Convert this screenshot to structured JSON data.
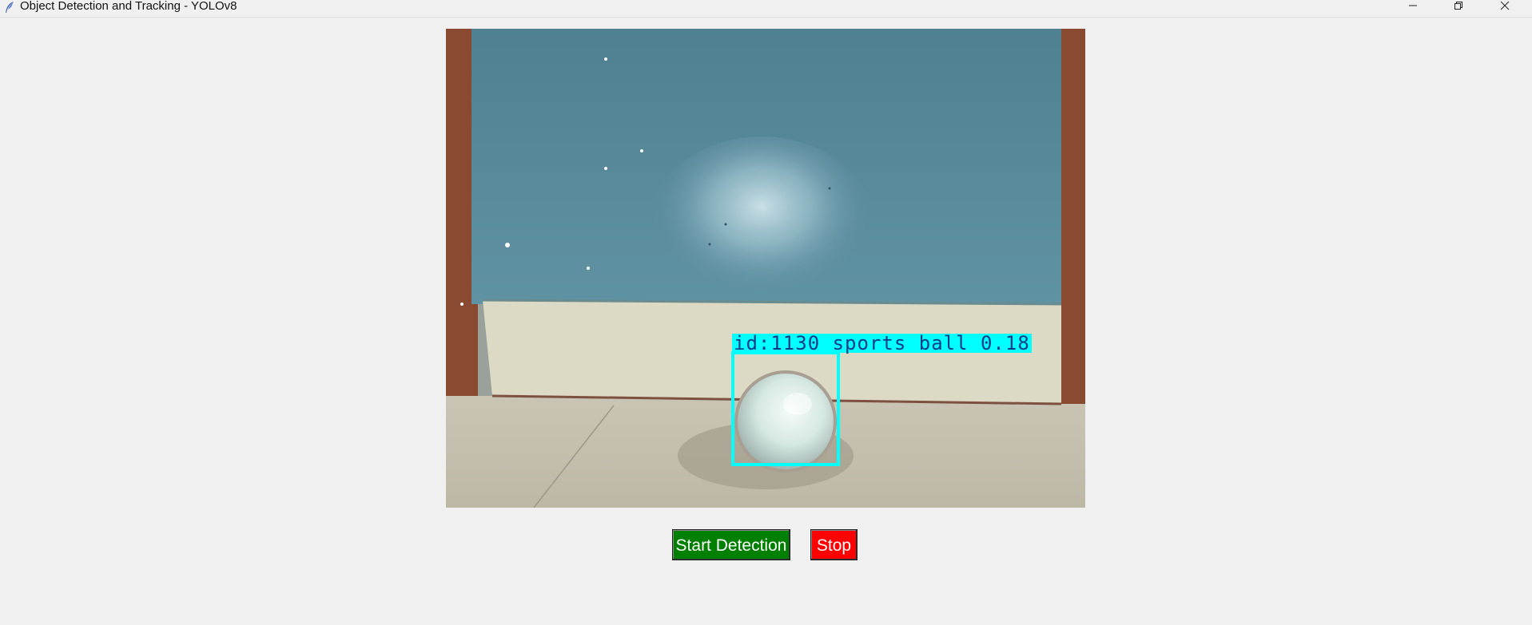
{
  "window": {
    "title": "Object Detection and Tracking - YOLOv8",
    "app_icon": "feather-icon",
    "controls": [
      "minimize-icon",
      "restore-icon",
      "close-icon"
    ]
  },
  "video_feed": {
    "detection": {
      "label": "id:1130 sports ball 0.18",
      "track_id": 1130,
      "class": "sports ball",
      "confidence": 0.18,
      "box_color": "#00ffff"
    }
  },
  "controls": {
    "start_label": "Start Detection",
    "stop_label": "Stop",
    "start_color": "#008000",
    "stop_color": "#ff0000"
  }
}
